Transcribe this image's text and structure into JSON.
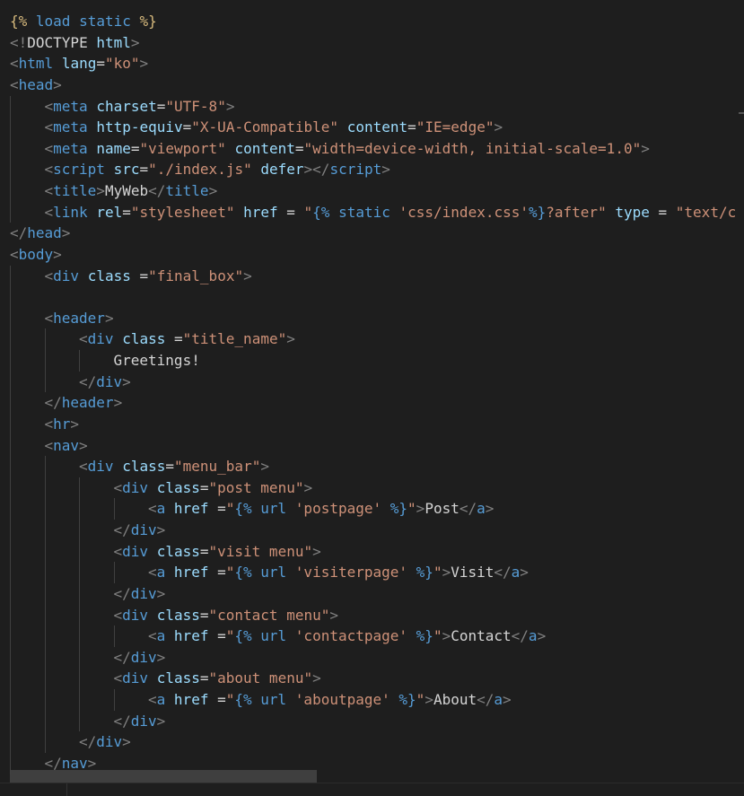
{
  "editor": {
    "language": "django-html",
    "lines": [
      {
        "indent": 0,
        "tokens": [
          {
            "c": "tmpl",
            "v": "{% "
          },
          {
            "c": "tmplkw",
            "v": "load static"
          },
          {
            "c": "tmpl",
            "v": " %}"
          }
        ]
      },
      {
        "indent": 0,
        "tokens": [
          {
            "c": "tag",
            "v": "<!"
          },
          {
            "c": "text",
            "v": "DOCTYPE"
          },
          {
            "c": "text",
            "v": " "
          },
          {
            "c": "attr",
            "v": "html"
          },
          {
            "c": "tag",
            "v": ">"
          }
        ]
      },
      {
        "indent": 0,
        "tokens": [
          {
            "c": "tag",
            "v": "<"
          },
          {
            "c": "name",
            "v": "html"
          },
          {
            "c": "text",
            "v": " "
          },
          {
            "c": "attr",
            "v": "lang"
          },
          {
            "c": "op",
            "v": "="
          },
          {
            "c": "str",
            "v": "\"ko\""
          },
          {
            "c": "tag",
            "v": ">"
          }
        ]
      },
      {
        "indent": 0,
        "tokens": [
          {
            "c": "tag",
            "v": "<"
          },
          {
            "c": "name",
            "v": "head"
          },
          {
            "c": "tag",
            "v": ">"
          }
        ]
      },
      {
        "indent": 1,
        "tokens": [
          {
            "c": "tag",
            "v": "<"
          },
          {
            "c": "name",
            "v": "meta"
          },
          {
            "c": "text",
            "v": " "
          },
          {
            "c": "attr",
            "v": "charset"
          },
          {
            "c": "op",
            "v": "="
          },
          {
            "c": "str",
            "v": "\"UTF-8\""
          },
          {
            "c": "tag",
            "v": ">"
          }
        ]
      },
      {
        "indent": 1,
        "tokens": [
          {
            "c": "tag",
            "v": "<"
          },
          {
            "c": "name",
            "v": "meta"
          },
          {
            "c": "text",
            "v": " "
          },
          {
            "c": "attr",
            "v": "http-equiv"
          },
          {
            "c": "op",
            "v": "="
          },
          {
            "c": "str",
            "v": "\"X-UA-Compatible\""
          },
          {
            "c": "text",
            "v": " "
          },
          {
            "c": "attr",
            "v": "content"
          },
          {
            "c": "op",
            "v": "="
          },
          {
            "c": "str",
            "v": "\"IE=edge\""
          },
          {
            "c": "tag",
            "v": ">"
          }
        ]
      },
      {
        "indent": 1,
        "tokens": [
          {
            "c": "tag",
            "v": "<"
          },
          {
            "c": "name",
            "v": "meta"
          },
          {
            "c": "text",
            "v": " "
          },
          {
            "c": "attr",
            "v": "name"
          },
          {
            "c": "op",
            "v": "="
          },
          {
            "c": "str",
            "v": "\"viewport\""
          },
          {
            "c": "text",
            "v": " "
          },
          {
            "c": "attr",
            "v": "content"
          },
          {
            "c": "op",
            "v": "="
          },
          {
            "c": "str",
            "v": "\"width=device-width, initial-scale=1.0\""
          },
          {
            "c": "tag",
            "v": ">"
          }
        ]
      },
      {
        "indent": 1,
        "tokens": [
          {
            "c": "tag",
            "v": "<"
          },
          {
            "c": "name",
            "v": "script"
          },
          {
            "c": "text",
            "v": " "
          },
          {
            "c": "attr",
            "v": "src"
          },
          {
            "c": "op",
            "v": "="
          },
          {
            "c": "str",
            "v": "\"./index.js\""
          },
          {
            "c": "text",
            "v": " "
          },
          {
            "c": "attr",
            "v": "defer"
          },
          {
            "c": "tag",
            "v": "></"
          },
          {
            "c": "name",
            "v": "script"
          },
          {
            "c": "tag",
            "v": ">"
          }
        ]
      },
      {
        "indent": 1,
        "tokens": [
          {
            "c": "tag",
            "v": "<"
          },
          {
            "c": "name",
            "v": "title"
          },
          {
            "c": "tag",
            "v": ">"
          },
          {
            "c": "text",
            "v": "MyWeb"
          },
          {
            "c": "tag",
            "v": "</"
          },
          {
            "c": "name",
            "v": "title"
          },
          {
            "c": "tag",
            "v": ">"
          }
        ]
      },
      {
        "indent": 1,
        "tokens": [
          {
            "c": "tag",
            "v": "<"
          },
          {
            "c": "name",
            "v": "link"
          },
          {
            "c": "text",
            "v": " "
          },
          {
            "c": "attr",
            "v": "rel"
          },
          {
            "c": "op",
            "v": "="
          },
          {
            "c": "str",
            "v": "\"stylesheet\""
          },
          {
            "c": "text",
            "v": " "
          },
          {
            "c": "attr",
            "v": "href"
          },
          {
            "c": "op",
            "v": " = "
          },
          {
            "c": "str",
            "v": "\""
          },
          {
            "c": "tmplkw",
            "v": "{% static "
          },
          {
            "c": "str",
            "v": "'css/index.css'"
          },
          {
            "c": "tmplkw",
            "v": "%}"
          },
          {
            "c": "str",
            "v": "?after\""
          },
          {
            "c": "text",
            "v": " "
          },
          {
            "c": "attr",
            "v": "type"
          },
          {
            "c": "op",
            "v": " = "
          },
          {
            "c": "str",
            "v": "\"text/c"
          }
        ]
      },
      {
        "indent": 0,
        "tokens": [
          {
            "c": "tag",
            "v": "</"
          },
          {
            "c": "name",
            "v": "head"
          },
          {
            "c": "tag",
            "v": ">"
          }
        ]
      },
      {
        "indent": 0,
        "tokens": [
          {
            "c": "tag",
            "v": "<"
          },
          {
            "c": "name",
            "v": "body"
          },
          {
            "c": "tag",
            "v": ">"
          }
        ]
      },
      {
        "indent": 1,
        "tokens": [
          {
            "c": "tag",
            "v": "<"
          },
          {
            "c": "name",
            "v": "div"
          },
          {
            "c": "text",
            "v": " "
          },
          {
            "c": "attr",
            "v": "class"
          },
          {
            "c": "op",
            "v": " ="
          },
          {
            "c": "str",
            "v": "\"final_box\""
          },
          {
            "c": "tag",
            "v": ">"
          }
        ]
      },
      {
        "indent": 1,
        "tokens": []
      },
      {
        "indent": 1,
        "tokens": [
          {
            "c": "tag",
            "v": "<"
          },
          {
            "c": "name",
            "v": "header"
          },
          {
            "c": "tag",
            "v": ">"
          }
        ]
      },
      {
        "indent": 2,
        "tokens": [
          {
            "c": "tag",
            "v": "<"
          },
          {
            "c": "name",
            "v": "div"
          },
          {
            "c": "text",
            "v": " "
          },
          {
            "c": "attr",
            "v": "class"
          },
          {
            "c": "op",
            "v": " ="
          },
          {
            "c": "str",
            "v": "\"title_name\""
          },
          {
            "c": "tag",
            "v": ">"
          }
        ]
      },
      {
        "indent": 3,
        "tokens": [
          {
            "c": "text",
            "v": "Greetings!"
          }
        ]
      },
      {
        "indent": 2,
        "tokens": [
          {
            "c": "tag",
            "v": "</"
          },
          {
            "c": "name",
            "v": "div"
          },
          {
            "c": "tag",
            "v": ">"
          }
        ]
      },
      {
        "indent": 1,
        "tokens": [
          {
            "c": "tag",
            "v": "</"
          },
          {
            "c": "name",
            "v": "header"
          },
          {
            "c": "tag",
            "v": ">"
          }
        ]
      },
      {
        "indent": 1,
        "tokens": [
          {
            "c": "tag",
            "v": "<"
          },
          {
            "c": "name",
            "v": "hr"
          },
          {
            "c": "tag",
            "v": ">"
          }
        ]
      },
      {
        "indent": 1,
        "tokens": [
          {
            "c": "tag",
            "v": "<"
          },
          {
            "c": "name",
            "v": "nav"
          },
          {
            "c": "tag",
            "v": ">"
          }
        ]
      },
      {
        "indent": 2,
        "tokens": [
          {
            "c": "tag",
            "v": "<"
          },
          {
            "c": "name",
            "v": "div"
          },
          {
            "c": "text",
            "v": " "
          },
          {
            "c": "attr",
            "v": "class"
          },
          {
            "c": "op",
            "v": "="
          },
          {
            "c": "str",
            "v": "\"menu_bar\""
          },
          {
            "c": "tag",
            "v": ">"
          }
        ]
      },
      {
        "indent": 3,
        "tokens": [
          {
            "c": "tag",
            "v": "<"
          },
          {
            "c": "name",
            "v": "div"
          },
          {
            "c": "text",
            "v": " "
          },
          {
            "c": "attr",
            "v": "class"
          },
          {
            "c": "op",
            "v": "="
          },
          {
            "c": "str",
            "v": "\"post menu\""
          },
          {
            "c": "tag",
            "v": ">"
          }
        ]
      },
      {
        "indent": 4,
        "tokens": [
          {
            "c": "tag",
            "v": "<"
          },
          {
            "c": "name",
            "v": "a"
          },
          {
            "c": "text",
            "v": " "
          },
          {
            "c": "attr",
            "v": "href"
          },
          {
            "c": "op",
            "v": " ="
          },
          {
            "c": "str",
            "v": "\""
          },
          {
            "c": "tmplkw",
            "v": "{% url "
          },
          {
            "c": "str",
            "v": "'postpage'"
          },
          {
            "c": "tmplkw",
            "v": " %}"
          },
          {
            "c": "str",
            "v": "\""
          },
          {
            "c": "tag",
            "v": ">"
          },
          {
            "c": "text",
            "v": "Post"
          },
          {
            "c": "tag",
            "v": "</"
          },
          {
            "c": "name",
            "v": "a"
          },
          {
            "c": "tag",
            "v": ">"
          }
        ]
      },
      {
        "indent": 3,
        "tokens": [
          {
            "c": "tag",
            "v": "</"
          },
          {
            "c": "name",
            "v": "div"
          },
          {
            "c": "tag",
            "v": ">"
          }
        ]
      },
      {
        "indent": 3,
        "tokens": [
          {
            "c": "tag",
            "v": "<"
          },
          {
            "c": "name",
            "v": "div"
          },
          {
            "c": "text",
            "v": " "
          },
          {
            "c": "attr",
            "v": "class"
          },
          {
            "c": "op",
            "v": "="
          },
          {
            "c": "str",
            "v": "\"visit menu\""
          },
          {
            "c": "tag",
            "v": ">"
          }
        ]
      },
      {
        "indent": 4,
        "tokens": [
          {
            "c": "tag",
            "v": "<"
          },
          {
            "c": "name",
            "v": "a"
          },
          {
            "c": "text",
            "v": " "
          },
          {
            "c": "attr",
            "v": "href"
          },
          {
            "c": "op",
            "v": " ="
          },
          {
            "c": "str",
            "v": "\""
          },
          {
            "c": "tmplkw",
            "v": "{% url "
          },
          {
            "c": "str",
            "v": "'visiterpage'"
          },
          {
            "c": "tmplkw",
            "v": " %}"
          },
          {
            "c": "str",
            "v": "\""
          },
          {
            "c": "tag",
            "v": ">"
          },
          {
            "c": "text",
            "v": "Visit"
          },
          {
            "c": "tag",
            "v": "</"
          },
          {
            "c": "name",
            "v": "a"
          },
          {
            "c": "tag",
            "v": ">"
          }
        ]
      },
      {
        "indent": 3,
        "tokens": [
          {
            "c": "tag",
            "v": "</"
          },
          {
            "c": "name",
            "v": "div"
          },
          {
            "c": "tag",
            "v": ">"
          }
        ]
      },
      {
        "indent": 3,
        "tokens": [
          {
            "c": "tag",
            "v": "<"
          },
          {
            "c": "name",
            "v": "div"
          },
          {
            "c": "text",
            "v": " "
          },
          {
            "c": "attr",
            "v": "class"
          },
          {
            "c": "op",
            "v": "="
          },
          {
            "c": "str",
            "v": "\"contact menu\""
          },
          {
            "c": "tag",
            "v": ">"
          }
        ]
      },
      {
        "indent": 4,
        "tokens": [
          {
            "c": "tag",
            "v": "<"
          },
          {
            "c": "name",
            "v": "a"
          },
          {
            "c": "text",
            "v": " "
          },
          {
            "c": "attr",
            "v": "href"
          },
          {
            "c": "op",
            "v": " ="
          },
          {
            "c": "str",
            "v": "\""
          },
          {
            "c": "tmplkw",
            "v": "{% url "
          },
          {
            "c": "str",
            "v": "'contactpage'"
          },
          {
            "c": "tmplkw",
            "v": " %}"
          },
          {
            "c": "str",
            "v": "\""
          },
          {
            "c": "tag",
            "v": ">"
          },
          {
            "c": "text",
            "v": "Contact"
          },
          {
            "c": "tag",
            "v": "</"
          },
          {
            "c": "name",
            "v": "a"
          },
          {
            "c": "tag",
            "v": ">"
          }
        ]
      },
      {
        "indent": 3,
        "tokens": [
          {
            "c": "tag",
            "v": "</"
          },
          {
            "c": "name",
            "v": "div"
          },
          {
            "c": "tag",
            "v": ">"
          }
        ]
      },
      {
        "indent": 3,
        "tokens": [
          {
            "c": "tag",
            "v": "<"
          },
          {
            "c": "name",
            "v": "div"
          },
          {
            "c": "text",
            "v": " "
          },
          {
            "c": "attr",
            "v": "class"
          },
          {
            "c": "op",
            "v": "="
          },
          {
            "c": "str",
            "v": "\"about menu\""
          },
          {
            "c": "tag",
            "v": ">"
          }
        ]
      },
      {
        "indent": 4,
        "tokens": [
          {
            "c": "tag",
            "v": "<"
          },
          {
            "c": "name",
            "v": "a"
          },
          {
            "c": "text",
            "v": " "
          },
          {
            "c": "attr",
            "v": "href"
          },
          {
            "c": "op",
            "v": " ="
          },
          {
            "c": "str",
            "v": "\""
          },
          {
            "c": "tmplkw",
            "v": "{% url "
          },
          {
            "c": "str",
            "v": "'aboutpage'"
          },
          {
            "c": "tmplkw",
            "v": " %}"
          },
          {
            "c": "str",
            "v": "\""
          },
          {
            "c": "tag",
            "v": ">"
          },
          {
            "c": "text",
            "v": "About"
          },
          {
            "c": "tag",
            "v": "</"
          },
          {
            "c": "name",
            "v": "a"
          },
          {
            "c": "tag",
            "v": ">"
          }
        ]
      },
      {
        "indent": 3,
        "tokens": [
          {
            "c": "tag",
            "v": "</"
          },
          {
            "c": "name",
            "v": "div"
          },
          {
            "c": "tag",
            "v": ">"
          }
        ]
      },
      {
        "indent": 2,
        "tokens": [
          {
            "c": "tag",
            "v": "</"
          },
          {
            "c": "name",
            "v": "div"
          },
          {
            "c": "tag",
            "v": ">"
          }
        ]
      },
      {
        "indent": 1,
        "tokens": [
          {
            "c": "tag",
            "v": "</"
          },
          {
            "c": "name",
            "v": "nav"
          },
          {
            "c": "tag",
            "v": ">"
          }
        ]
      }
    ]
  },
  "colors": {
    "background": "#1e1e1e",
    "tag_bracket": "#808080",
    "tag_name": "#569cd6",
    "attribute": "#9cdcfe",
    "string": "#ce9178",
    "text": "#d4d4d4",
    "template_delimiter": "#d7ba7d",
    "template_keyword": "#569cd6"
  }
}
